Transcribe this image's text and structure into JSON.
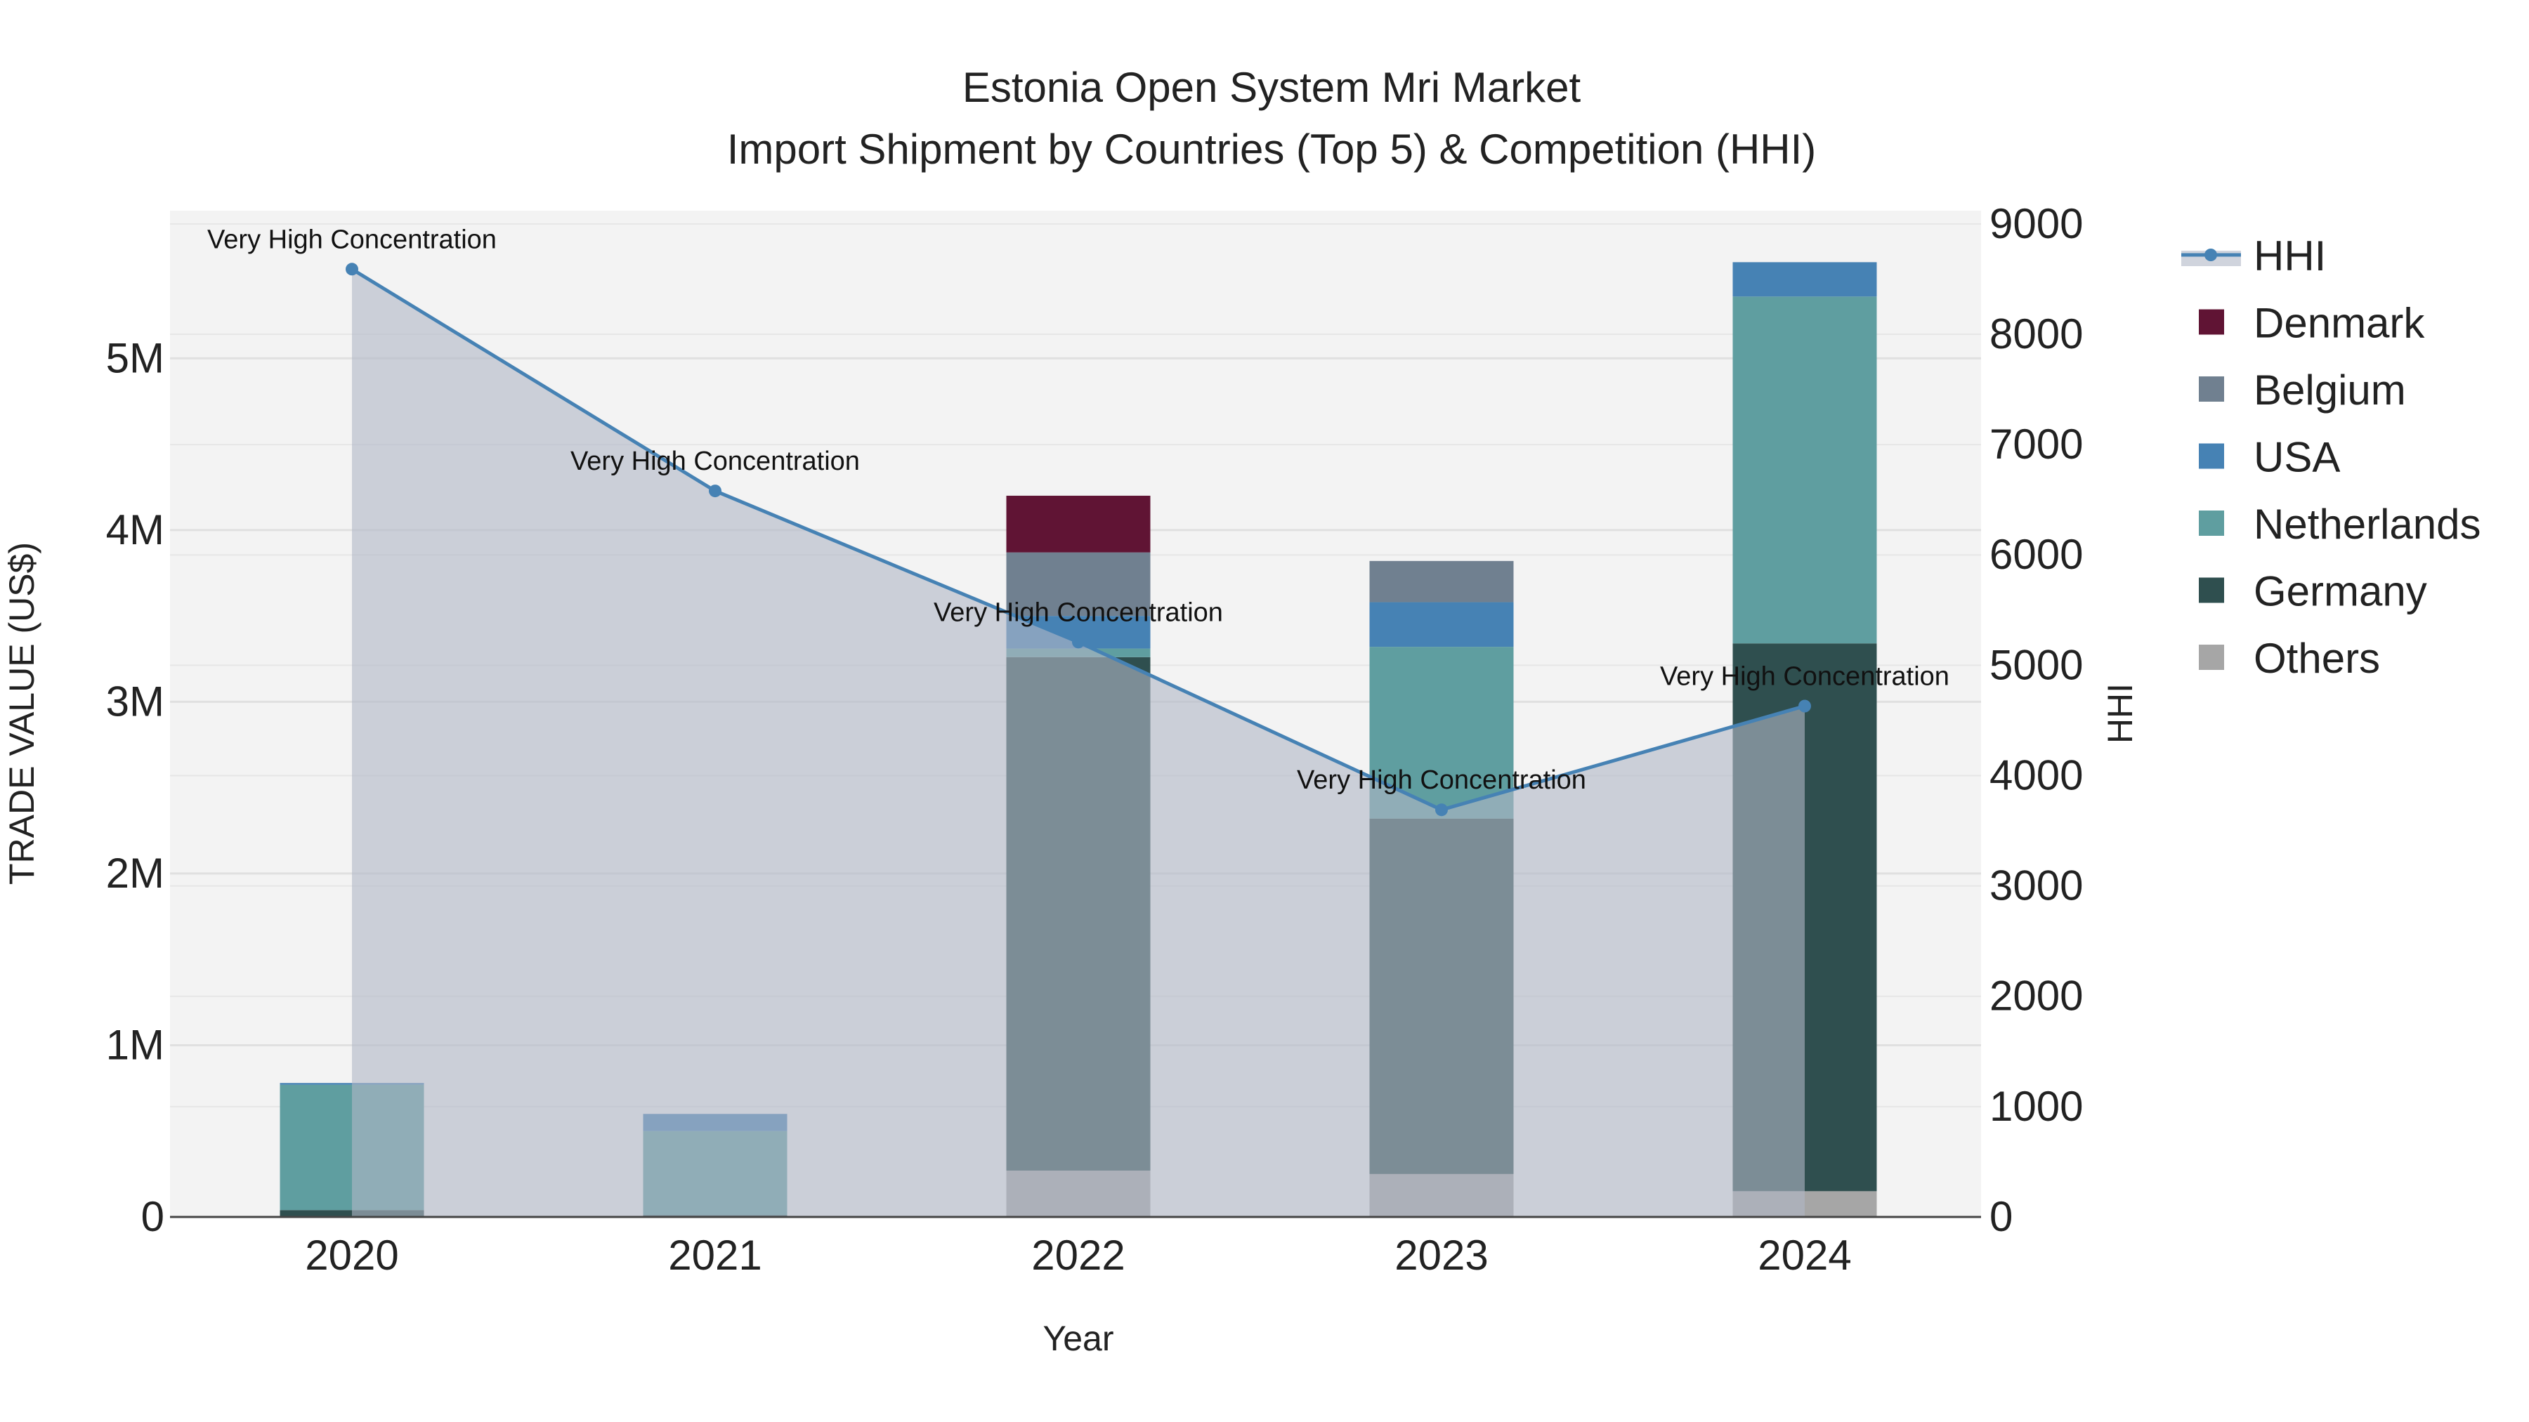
{
  "chart_data": {
    "type": "bar",
    "title": "Estonia Open System Mri Market",
    "subtitle": "Import Shipment by Countries (Top 5) & Competition (HHI)",
    "xlabel": "Year",
    "ylabel": "TRADE VALUE (US$)",
    "y2label": "HHI",
    "categories": [
      "2020",
      "2021",
      "2022",
      "2023",
      "2024"
    ],
    "ylim": [
      0,
      5860000
    ],
    "y2lim": [
      0,
      9120
    ],
    "yticks": [
      0,
      1000000,
      2000000,
      3000000,
      4000000,
      5000000
    ],
    "ytick_labels": [
      "0",
      "1M",
      "2M",
      "3M",
      "4M",
      "5M"
    ],
    "y2ticks": [
      0,
      1000,
      2000,
      3000,
      4000,
      5000,
      6000,
      7000,
      8000,
      9000
    ],
    "y2tick_labels": [
      "0",
      "1000",
      "2000",
      "3000",
      "4000",
      "5000",
      "6000",
      "7000",
      "8000",
      "9000"
    ],
    "stacked": true,
    "series": [
      {
        "name": "Others",
        "color": "#a6a6a6",
        "values": [
          0,
          0,
          270000,
          250000,
          150000
        ]
      },
      {
        "name": "Germany",
        "color": "#2f4f4f",
        "values": [
          40000,
          10000,
          2990000,
          2070000,
          3190000
        ]
      },
      {
        "name": "Netherlands",
        "color": "#5f9ea0",
        "values": [
          730000,
          490000,
          50000,
          1000000,
          2020000
        ]
      },
      {
        "name": "USA",
        "color": "#4682b4",
        "values": [
          10000,
          100000,
          190000,
          260000,
          200000
        ]
      },
      {
        "name": "Belgium",
        "color": "#708090",
        "values": [
          0,
          0,
          370000,
          240000,
          0
        ]
      },
      {
        "name": "Denmark",
        "color": "#601434",
        "values": [
          0,
          0,
          330000,
          0,
          0
        ]
      }
    ],
    "hhi": {
      "name": "HHI",
      "color": "#4682b4",
      "values": [
        8590,
        6580,
        5210,
        3690,
        4630
      ],
      "annotations": [
        "Very High Concentration",
        "Very High Concentration",
        "Very High Concentration",
        "Very High Concentration",
        "Very High Concentration"
      ]
    },
    "legend": [
      "HHI",
      "Denmark",
      "Belgium",
      "USA",
      "Netherlands",
      "Germany",
      "Others"
    ],
    "legend_placement": "right",
    "grid": true
  }
}
